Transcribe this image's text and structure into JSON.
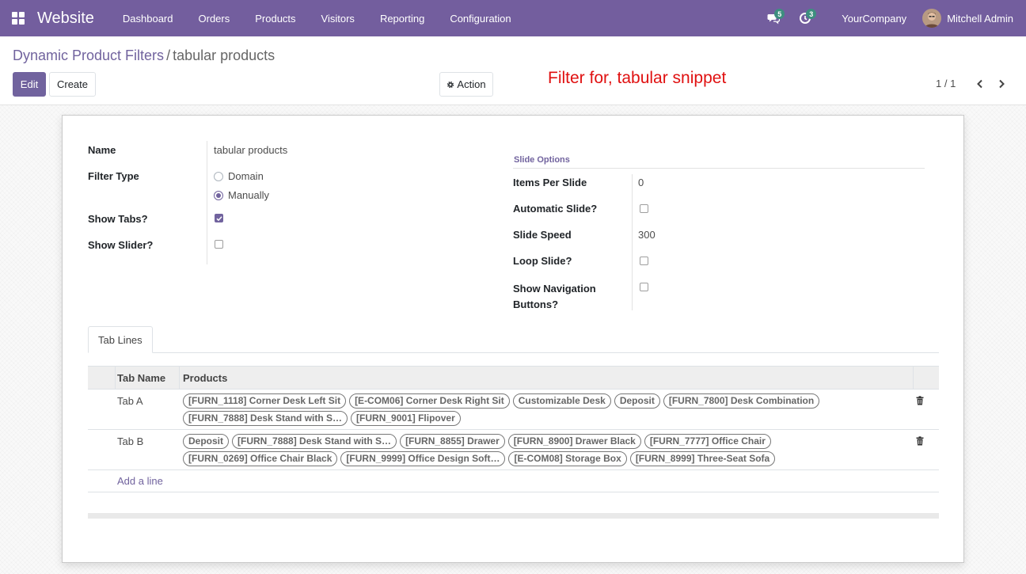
{
  "navbar": {
    "brand": "Website",
    "menu": [
      "Dashboard",
      "Orders",
      "Products",
      "Visitors",
      "Reporting",
      "Configuration"
    ],
    "messages_count": "5",
    "activities_count": "3",
    "company": "YourCompany",
    "user": "Mitchell Admin"
  },
  "breadcrumb": {
    "parent": "Dynamic Product Filters",
    "separator": "/",
    "current": "tabular products"
  },
  "buttons": {
    "edit": "Edit",
    "create": "Create",
    "action": "Action"
  },
  "annotation": "Filter for, tabular snippet",
  "pager": "1 / 1",
  "form": {
    "name_label": "Name",
    "name_value": "tabular products",
    "filter_type_label": "Filter Type",
    "filter_type_options": [
      {
        "label": "Domain",
        "checked": false
      },
      {
        "label": "Manually",
        "checked": true
      }
    ],
    "show_tabs_label": "Show Tabs?",
    "show_tabs": true,
    "show_slider_label": "Show Slider?",
    "show_slider": false,
    "slide_options_title": "Slide Options",
    "items_per_slide_label": "Items Per Slide",
    "items_per_slide": "0",
    "automatic_slide_label": "Automatic Slide?",
    "automatic_slide": false,
    "slide_speed_label": "Slide Speed",
    "slide_speed": "300",
    "loop_slide_label": "Loop Slide?",
    "loop_slide": false,
    "show_nav_label_line1": "Show Navigation",
    "show_nav_label_line2": "Buttons?",
    "show_nav": false
  },
  "tabs": [
    "Tab Lines"
  ],
  "table": {
    "headers": [
      "Tab Name",
      "Products"
    ],
    "rows": [
      {
        "name": "Tab A",
        "products": [
          "[FURN_1118] Corner Desk Left Sit",
          "[E-COM06] Corner Desk Right Sit",
          "Customizable Desk",
          "Deposit",
          "[FURN_7800] Desk Combination",
          "[FURN_7888] Desk Stand with S…",
          "[FURN_9001] Flipover"
        ]
      },
      {
        "name": "Tab B",
        "products": [
          "Deposit",
          "[FURN_7888] Desk Stand with S…",
          "[FURN_8855] Drawer",
          "[FURN_8900] Drawer Black",
          "[FURN_7777] Office Chair",
          "[FURN_0269] Office Chair Black",
          "[FURN_9999] Office Design Soft…",
          "[E-COM08] Storage Box",
          "[FURN_8999] Three-Seat Sofa"
        ]
      }
    ],
    "add_line": "Add a line"
  },
  "colors": {
    "navbar": "#735e9e",
    "primary": "#71639e",
    "annotation": "#e01010"
  }
}
